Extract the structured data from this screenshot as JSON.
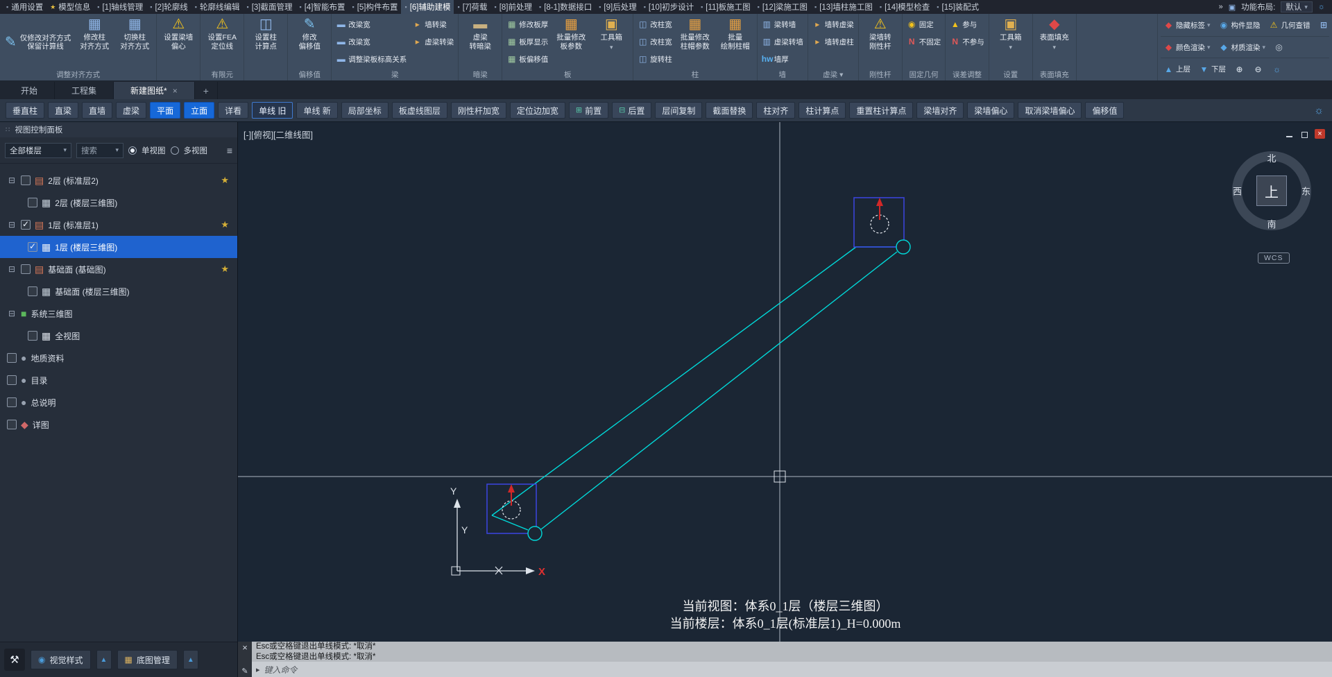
{
  "colors": {
    "accent_blue": "#1668d8",
    "selection_blue": "#1f63cf",
    "cyan": "#00d9d9",
    "warning_yellow": "#f2c21c",
    "column_blue": "#3a43d8",
    "marker_red": "#d22828",
    "ribbon_bg": "#3e4d60",
    "canvas_bg": "#1b2634"
  },
  "menubar": {
    "items": [
      {
        "label": "通用设置"
      },
      {
        "label": "模型信息",
        "icon": "star"
      },
      {
        "label": "[1]轴线管理"
      },
      {
        "label": "[2]轮廓线"
      },
      {
        "label": "轮廓线编辑"
      },
      {
        "label": "[3]截面管理"
      },
      {
        "label": "[4]智能布置"
      },
      {
        "label": "[5]构件布置"
      },
      {
        "label": "[6]辅助建模",
        "active": true
      },
      {
        "label": "[7]荷载"
      },
      {
        "label": "[8]前处理"
      },
      {
        "label": "[8-1]数据接口"
      },
      {
        "label": "[9]后处理"
      },
      {
        "label": "[10]初步设计"
      },
      {
        "label": "[11]板施工图"
      },
      {
        "label": "[12]梁施工图"
      },
      {
        "label": "[13]墙柱施工图"
      },
      {
        "label": "[14]模型检查"
      },
      {
        "label": "[15]装配式"
      }
    ],
    "overflow": "»",
    "layout_label": "功能布局:",
    "layout_value": "默认"
  },
  "ribbon": {
    "groups": [
      {
        "label": "调整对齐方式",
        "cols": [
          {
            "w": "wide",
            "btns": [
              {
                "t": [
                  "仅修改对齐方式",
                  "保留计算线"
                ],
                "i": "edit"
              }
            ]
          },
          {
            "w": "big",
            "btns": [
              {
                "t": [
                  "修改柱",
                  "对齐方式"
                ],
                "i": "column-grid"
              }
            ]
          },
          {
            "w": "big",
            "btns": [
              {
                "t": [
                  "切换柱",
                  "对齐方式"
                ],
                "i": "column-grid"
              }
            ]
          }
        ]
      },
      {
        "label": "",
        "cols": [
          {
            "w": "big",
            "btns": [
              {
                "t": [
                  "设置梁墙",
                  "偏心"
                ],
                "i": "warning"
              }
            ]
          }
        ]
      },
      {
        "label": "有限元",
        "cols": [
          {
            "w": "big",
            "btns": [
              {
                "t": [
                  "设置FEA",
                  "定位线"
                ],
                "i": "warning"
              }
            ]
          }
        ]
      },
      {
        "label": "",
        "cols": [
          {
            "w": "big",
            "btns": [
              {
                "t": [
                  "设置柱",
                  "计算点"
                ],
                "i": "column-point"
              }
            ]
          }
        ]
      },
      {
        "label": "偏移值",
        "cols": [
          {
            "w": "big",
            "btns": [
              {
                "t": [
                  "修改",
                  "偏移值"
                ],
                "i": "edit"
              }
            ]
          }
        ]
      },
      {
        "label": "梁",
        "cols": [
          {
            "w": "small",
            "btns": [
              {
                "t": [
                  "改梁宽"
                ],
                "i": "beam"
              },
              {
                "t": [
                  "改梁宽"
                ],
                "i": "beam"
              },
              {
                "t": [
                  "调整梁板标高关系"
                ],
                "i": "beam"
              }
            ]
          },
          {
            "w": "small",
            "btns": [
              {
                "t": [
                  "墙转梁"
                ],
                "i": "convert"
              },
              {
                "t": [
                  "虚梁转梁"
                ],
                "i": "convert"
              }
            ]
          }
        ]
      },
      {
        "label": "暗梁",
        "cols": [
          {
            "w": "big",
            "btns": [
              {
                "t": [
                  "虚梁",
                  "转暗梁"
                ],
                "i": "beam-dark"
              }
            ]
          }
        ]
      },
      {
        "label": "板",
        "cols": [
          {
            "w": "small",
            "btns": [
              {
                "t": [
                  "修改板厚"
                ],
                "i": "slab"
              },
              {
                "t": [
                  "板厚显示"
                ],
                "i": "slab"
              },
              {
                "t": [
                  "板偏移值"
                ],
                "i": "slab"
              }
            ]
          },
          {
            "w": "big",
            "btns": [
              {
                "t": [
                  "批量修改",
                  "板参数"
                ],
                "i": "batch"
              }
            ]
          },
          {
            "w": "big",
            "btns": [
              {
                "t": [
                  "工具箱"
                ],
                "i": "toolbox",
                "caret": true
              }
            ]
          }
        ]
      },
      {
        "label": "柱",
        "cols": [
          {
            "w": "small",
            "btns": [
              {
                "t": [
                  "改柱宽"
                ],
                "i": "column"
              },
              {
                "t": [
                  "改柱宽"
                ],
                "i": "column"
              },
              {
                "t": [
                  "旋转柱"
                ],
                "i": "column"
              }
            ]
          },
          {
            "w": "big",
            "btns": [
              {
                "t": [
                  "批量修改",
                  "柱帽参数"
                ],
                "i": "batch"
              }
            ]
          },
          {
            "w": "big",
            "btns": [
              {
                "t": [
                  "批量",
                  "绘制柱帽"
                ],
                "i": "batch"
              }
            ]
          }
        ]
      },
      {
        "label": "墙",
        "cols": [
          {
            "w": "small",
            "btns": [
              {
                "t": [
                  "梁转墙"
                ],
                "i": "wall"
              },
              {
                "t": [
                  "虚梁转墙"
                ],
                "i": "wall"
              },
              {
                "t": [
                  "墙厚"
                ],
                "i": "hw"
              }
            ]
          }
        ]
      },
      {
        "label": "虚梁 ▾",
        "cols": [
          {
            "w": "small",
            "btns": [
              {
                "t": [
                  "墙转虚梁"
                ],
                "i": "convert"
              },
              {
                "t": [
                  "墙转虚柱"
                ],
                "i": "convert"
              }
            ]
          }
        ]
      },
      {
        "label": "刚性杆",
        "cols": [
          {
            "w": "big",
            "btns": [
              {
                "t": [
                  "梁墙转",
                  "刚性杆"
                ],
                "i": "warning"
              }
            ]
          }
        ]
      },
      {
        "label": "固定几何",
        "cols": [
          {
            "w": "small",
            "btns": [
              {
                "t": [
                  "固定"
                ],
                "i": "pin"
              },
              {
                "t": [
                  "不固定"
                ],
                "i": "no"
              }
            ]
          }
        ]
      },
      {
        "label": "误差调整",
        "cols": [
          {
            "w": "small",
            "btns": [
              {
                "t": [
                  "参与"
                ],
                "i": "participate"
              },
              {
                "t": [
                  "不参与"
                ],
                "i": "no"
              }
            ]
          }
        ]
      },
      {
        "label": "设置",
        "cols": [
          {
            "w": "big",
            "btns": [
              {
                "t": [
                  "工具箱"
                ],
                "i": "toolbox",
                "caret": true
              }
            ]
          }
        ]
      },
      {
        "label": "表面填充",
        "cols": [
          {
            "w": "big",
            "btns": [
              {
                "t": [
                  "表面填充"
                ],
                "i": "fill-red",
                "caret": true
              }
            ]
          }
        ]
      }
    ],
    "right_rows": [
      [
        {
          "label": "隐藏标签",
          "i": "tag-red",
          "caret": true
        },
        {
          "label": "构件显隐",
          "i": "visibility"
        },
        {
          "label": "几何查错",
          "i": "warning-small"
        },
        {
          "label": "",
          "i": "panel"
        }
      ],
      [
        {
          "label": "颜色渲染",
          "i": "diamond-red",
          "caret": true
        },
        {
          "label": "材质渲染",
          "i": "diamond-blue",
          "caret": true
        },
        {
          "label": "",
          "i": "target"
        }
      ],
      [
        {
          "label": "上层",
          "i": "layer-up"
        },
        {
          "label": "下层",
          "i": "layer-down"
        },
        {
          "label": "",
          "i": "zoom-in"
        },
        {
          "label": "",
          "i": "zoom-out"
        },
        {
          "label": "",
          "i": "gear"
        }
      ]
    ]
  },
  "tabs": {
    "items": [
      {
        "label": "开始"
      },
      {
        "label": "工程集"
      },
      {
        "label": "新建图纸*",
        "active": true
      }
    ],
    "add": "+"
  },
  "toolbar": {
    "buttons": [
      {
        "label": "垂直柱"
      },
      {
        "label": "直梁"
      },
      {
        "label": "直墙"
      },
      {
        "label": "虚梁"
      },
      {
        "label": "平面",
        "style": "primary"
      },
      {
        "label": "立面",
        "style": "primary"
      },
      {
        "label": "详看"
      },
      {
        "label": "单线 旧",
        "style": "toggled"
      },
      {
        "label": "单线 新"
      },
      {
        "label": "局部坐标"
      },
      {
        "label": "板虚线图层"
      },
      {
        "label": "刚性杆加宽"
      },
      {
        "label": "定位边加宽"
      },
      {
        "label": "前置",
        "icon": "layer-front"
      },
      {
        "label": "后置",
        "icon": "layer-back"
      },
      {
        "label": "层间复制"
      },
      {
        "label": "截面替换"
      },
      {
        "label": "柱对齐"
      },
      {
        "label": "柱计算点"
      },
      {
        "label": "重置柱计算点"
      },
      {
        "label": "梁墙对齐"
      },
      {
        "label": "梁墙偏心"
      },
      {
        "label": "取消梁墙偏心"
      },
      {
        "label": "偏移值"
      }
    ]
  },
  "sidebar": {
    "title": "视图控制面板",
    "floor_filter": "全部楼层",
    "search_placeholder": "搜索",
    "view_single": "单视图",
    "view_multi": "多视图",
    "tree": [
      {
        "label": "2层 (标准层2)",
        "level": 0,
        "checked": false,
        "star": true
      },
      {
        "label": "2层 (楼层三维图)",
        "level": 1,
        "checked": false
      },
      {
        "label": "1层 (标准层1)",
        "level": 0,
        "checked": true,
        "star": true
      },
      {
        "label": "1层 (楼层三维图)",
        "level": 1,
        "checked": true,
        "selected": true
      },
      {
        "label": "基础面 (基础图)",
        "level": 0,
        "checked": false,
        "star": true
      },
      {
        "label": "基础面 (楼层三维图)",
        "level": 1,
        "checked": false
      },
      {
        "label": "系统三维图",
        "level": 0
      },
      {
        "label": "全视图",
        "level": 1,
        "checked": false
      },
      {
        "label": "地质资料",
        "checked": false
      },
      {
        "label": "目录",
        "checked": false
      },
      {
        "label": "总说明",
        "checked": false
      },
      {
        "label": "详图",
        "checked": false
      }
    ],
    "bottom": {
      "visual_style": "视觉样式",
      "base_map": "底图管理"
    }
  },
  "canvas": {
    "view_label": "[-][俯视][二维线图]",
    "compass": {
      "n": "北",
      "s": "南",
      "e": "东",
      "w": "西",
      "center": "上"
    },
    "wcs": "WCS",
    "axis": {
      "x": "X",
      "y": "Y"
    },
    "status_line1": "当前视图：体系0_1层（楼层三维图）",
    "status_line2": "当前楼层：体系0_1层(标准层1)_H=0.000m"
  },
  "command": {
    "history": [
      "Esc或空格键退出单线模式: *取消*",
      "Esc或空格键退出单线模式: *取消*"
    ],
    "input_placeholder": "键入命令"
  }
}
